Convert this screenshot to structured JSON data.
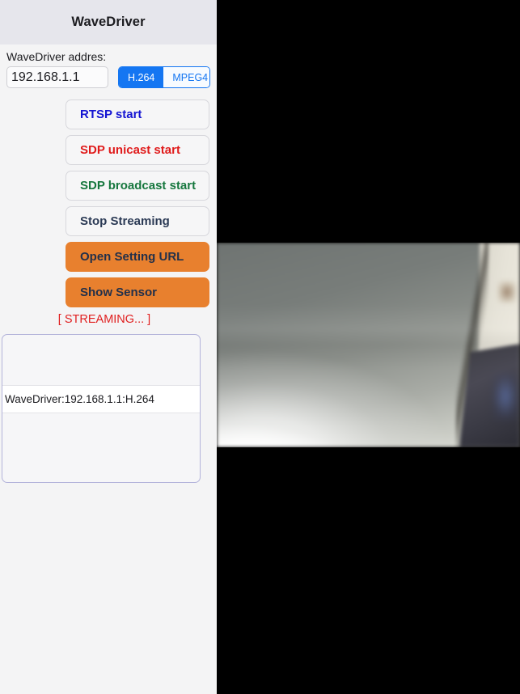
{
  "nav": {
    "title": "WaveDriver"
  },
  "address": {
    "label": "WaveDriver addres:",
    "value": "192.168.1.1",
    "placeholder": "192.168.1.1"
  },
  "codec_segment": {
    "options": [
      "H.264",
      "MPEG4"
    ],
    "selected": "H.264",
    "selected_bg": "#1476f2",
    "selected_fg": "#ffffff",
    "unselected_fg": "#1476f2"
  },
  "buttons": [
    {
      "label": "RTSP start",
      "style": "plain",
      "text_color": "#1414d2"
    },
    {
      "label": "SDP unicast start",
      "style": "plain",
      "text_color": "#e01b1b"
    },
    {
      "label": "SDP broadcast start",
      "style": "plain",
      "text_color": "#16773e"
    },
    {
      "label": "Stop Streaming",
      "style": "plain",
      "text_color": "#2b3a55"
    },
    {
      "label": "Open Setting URL",
      "style": "orange",
      "text_color": "#22304a"
    },
    {
      "label": "Show Sensor",
      "style": "orange",
      "text_color": "#22304a"
    }
  ],
  "status": {
    "text": "[ STREAMING... ]",
    "color": "#e02020"
  },
  "device_list": {
    "rows": [
      {
        "label": "",
        "selected": false
      },
      {
        "label": "",
        "selected": false
      },
      {
        "label": "WaveDriver:192.168.1.1:H.264",
        "selected": true
      },
      {
        "label": "",
        "selected": false
      },
      {
        "label": "",
        "selected": false
      }
    ],
    "border_color": "#b3b3da"
  },
  "video": {
    "label": "camera-preview",
    "background": "#000000",
    "state": "streaming"
  }
}
